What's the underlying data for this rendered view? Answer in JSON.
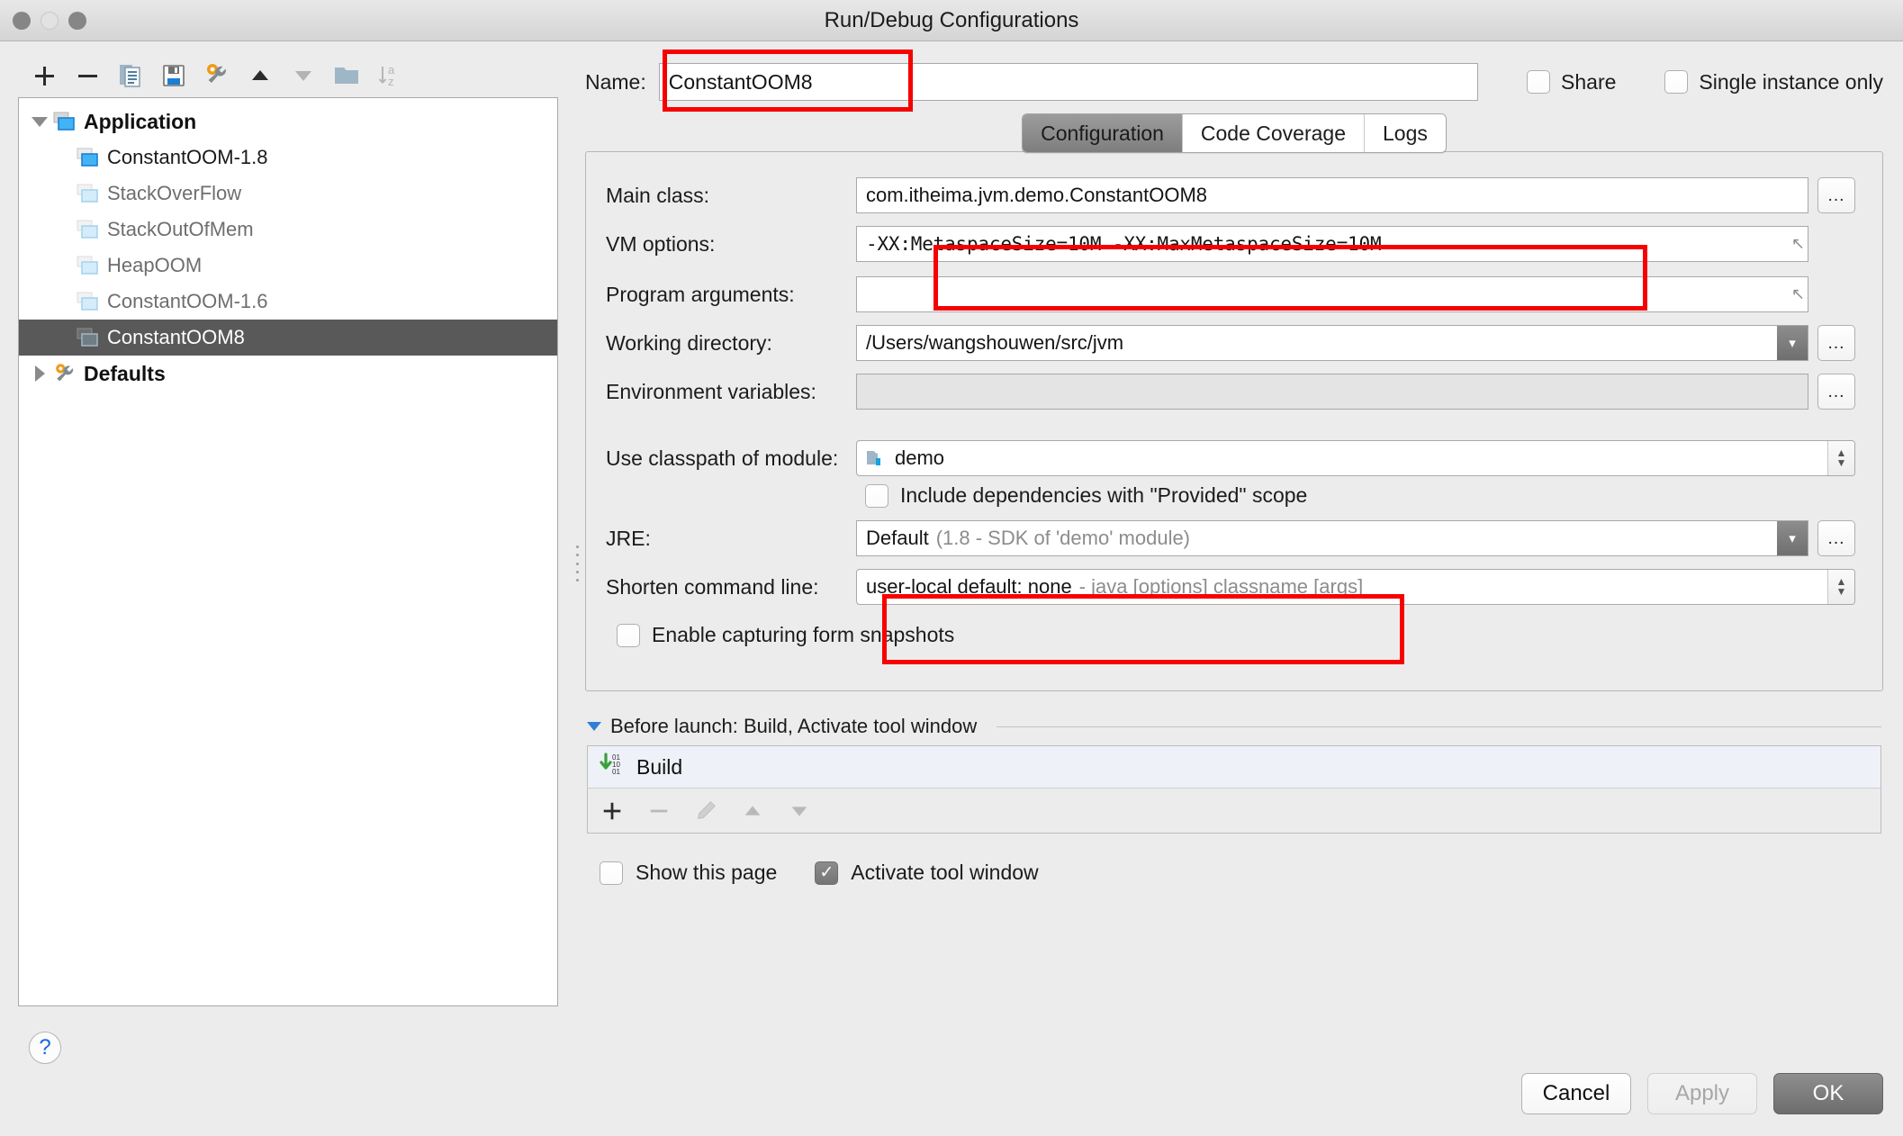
{
  "window": {
    "title": "Run/Debug Configurations"
  },
  "toolbar": {
    "buttons": [
      {
        "name": "add",
        "icon": "plus-icon",
        "label": "+"
      },
      {
        "name": "remove",
        "icon": "minus-icon",
        "label": "−"
      },
      {
        "name": "copy",
        "icon": "copy-icon",
        "label": "Copy Configuration"
      },
      {
        "name": "save",
        "icon": "save-icon",
        "label": "Save Configuration"
      },
      {
        "name": "edit-defaults",
        "icon": "wrench-icon",
        "label": "Edit defaults"
      },
      {
        "name": "move-up",
        "icon": "arrow-up-icon",
        "label": "Move Up"
      },
      {
        "name": "move-down",
        "icon": "arrow-down-icon",
        "label": "Move Down"
      },
      {
        "name": "new-folder",
        "icon": "folder-icon",
        "label": "Create New Folder"
      },
      {
        "name": "sort",
        "icon": "sort-az-icon",
        "label": "Sort Configurations"
      }
    ]
  },
  "tree": {
    "nodes": [
      {
        "label": "Application",
        "type": "root",
        "expanded": true,
        "depth": 0,
        "icon": "application-icon",
        "selected": false
      },
      {
        "label": "ConstantOOM-1.8",
        "type": "config",
        "depth": 1,
        "icon": "application-icon",
        "selected": false,
        "emphasis": "dark"
      },
      {
        "label": "StackOverFlow",
        "type": "config",
        "depth": 1,
        "icon": "application-icon",
        "selected": false,
        "emphasis": "muted"
      },
      {
        "label": "StackOutOfMem",
        "type": "config",
        "depth": 1,
        "icon": "application-icon",
        "selected": false,
        "emphasis": "muted"
      },
      {
        "label": "HeapOOM",
        "type": "config",
        "depth": 1,
        "icon": "application-icon",
        "selected": false,
        "emphasis": "muted"
      },
      {
        "label": "ConstantOOM-1.6",
        "type": "config",
        "depth": 1,
        "icon": "application-icon",
        "selected": false,
        "emphasis": "muted"
      },
      {
        "label": "ConstantOOM8",
        "type": "config",
        "depth": 1,
        "icon": "application-icon",
        "selected": true,
        "emphasis": "selected"
      },
      {
        "label": "Defaults",
        "type": "root",
        "expanded": false,
        "depth": 0,
        "icon": "wrench-icon",
        "selected": false
      }
    ]
  },
  "help": {
    "label": "?"
  },
  "name_row": {
    "label": "Name:",
    "value": "ConstantOOM8",
    "placeholder": "",
    "share_label": "Share",
    "share_checked": false,
    "single_instance_label": "Single instance only",
    "single_instance_checked": false
  },
  "tabs": [
    {
      "label": "Configuration",
      "active": true
    },
    {
      "label": "Code Coverage",
      "active": false
    },
    {
      "label": "Logs",
      "active": false
    }
  ],
  "form": {
    "main_class": {
      "label": "Main class:",
      "value": "com.itheima.jvm.demo.ConstantOOM8",
      "button": "…"
    },
    "vm_options": {
      "label": "VM options:",
      "value": "-XX:MetaspaceSize=10M  -XX:MaxMetaspaceSize=10M"
    },
    "program_arguments": {
      "label": "Program arguments:",
      "value": ""
    },
    "working_directory": {
      "label": "Working directory:",
      "value": "/Users/wangshouwen/src/jvm",
      "button": "…"
    },
    "environment_variables": {
      "label": "Environment variables:",
      "value": "",
      "button": "…",
      "disabled": true
    },
    "classpath_module": {
      "label": "Use classpath of module:",
      "value": "demo"
    },
    "include_provided": {
      "label": "Include dependencies with \"Provided\" scope",
      "checked": false
    },
    "jre": {
      "label": "JRE:",
      "value": "Default",
      "value_detail": "(1.8 - SDK of 'demo' module)",
      "button": "…"
    },
    "shorten_command_line": {
      "label": "Shorten command line:",
      "value": "user-local default: none",
      "value_detail": "- java [options] classname [args]"
    },
    "form_snapshots": {
      "label": "Enable capturing form snapshots",
      "checked": false
    }
  },
  "before_launch": {
    "header": "Before launch: Build, Activate tool window",
    "items": [
      {
        "label": "Build",
        "icon": "compile-icon"
      }
    ],
    "toolbar": [
      {
        "name": "add",
        "icon": "plus-icon",
        "enabled": true
      },
      {
        "name": "remove",
        "icon": "minus-icon",
        "enabled": false
      },
      {
        "name": "edit",
        "icon": "pencil-icon",
        "enabled": false
      },
      {
        "name": "move-up",
        "icon": "arrow-up-icon",
        "enabled": false
      },
      {
        "name": "move-down",
        "icon": "arrow-down-icon",
        "enabled": false
      }
    ],
    "show_page": {
      "label": "Show this page",
      "checked": false
    },
    "activate_tool_window": {
      "label": "Activate tool window",
      "checked": true
    }
  },
  "buttons": {
    "cancel": "Cancel",
    "apply": "Apply",
    "ok": "OK"
  },
  "colors": {
    "annotation": "#f60000",
    "selection": "#595959",
    "accent": "#2f7fd4",
    "window_bg": "#ececec"
  }
}
